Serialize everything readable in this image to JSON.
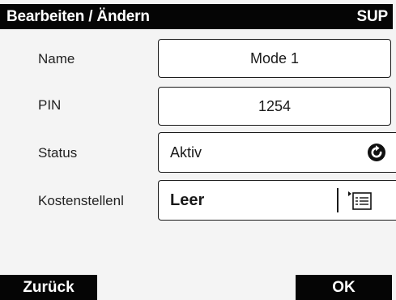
{
  "header": {
    "title": "Bearbeiten / Ändern",
    "badge": "SUP"
  },
  "form": {
    "name": {
      "label": "Name",
      "value": "Mode 1"
    },
    "pin": {
      "label": "PIN",
      "value": "1254"
    },
    "status": {
      "label": "Status",
      "value": "Aktiv",
      "icon": "refresh-icon"
    },
    "cost_center": {
      "label": "Kostenstellenl",
      "value": "Leer",
      "icon": "list-icon"
    }
  },
  "footer": {
    "back_label": "Zurück",
    "ok_label": "OK"
  },
  "colors": {
    "bar": "#050505",
    "background": "#f4f4f4",
    "field": "#ffffff"
  }
}
